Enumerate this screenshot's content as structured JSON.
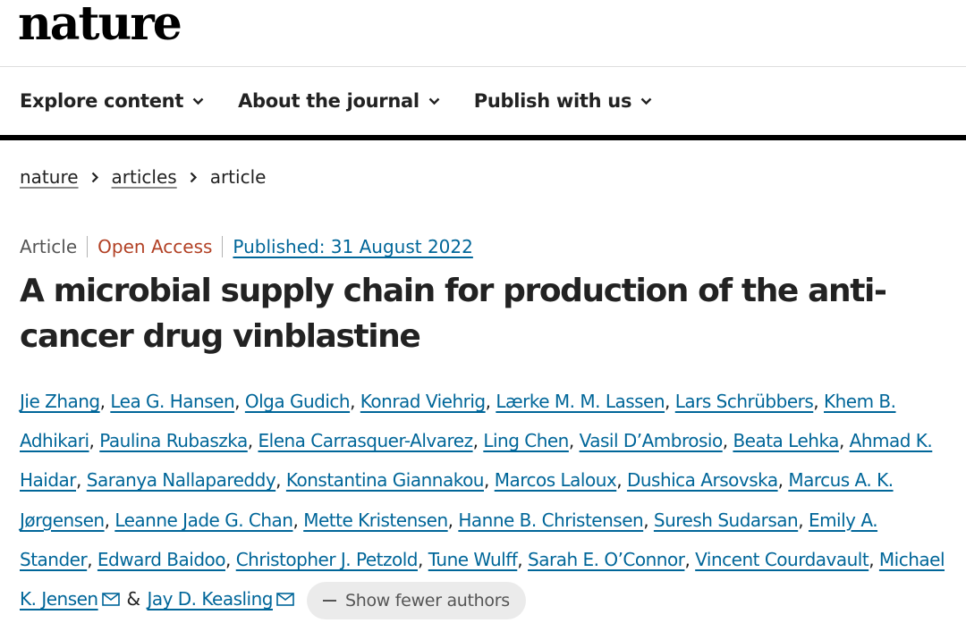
{
  "brand": {
    "logo_text": "nature"
  },
  "nav": {
    "items": [
      {
        "label": "Explore content"
      },
      {
        "label": "About the journal"
      },
      {
        "label": "Publish with us"
      }
    ]
  },
  "breadcrumb": {
    "items": [
      "nature",
      "articles",
      "article"
    ]
  },
  "meta": {
    "type": "Article",
    "access": "Open Access",
    "published": "Published: 31 August 2022"
  },
  "article": {
    "title": "A microbial supply chain for production of the anti-cancer drug vinblastine"
  },
  "authors": [
    "Jie Zhang",
    "Lea G. Hansen",
    "Olga Gudich",
    "Konrad Viehrig",
    "Lærke M. M. Lassen",
    "Lars Schrübbers",
    "Khem B. Adhikari",
    "Paulina Rubaszka",
    "Elena Carrasquer-Alvarez",
    "Ling Chen",
    "Vasil D’Ambrosio",
    "Beata Lehka",
    "Ahmad K. Haidar",
    "Saranya Nallapareddy",
    "Konstantina Giannakou",
    "Marcos Laloux",
    "Dushica Arsovska",
    "Marcus A. K. Jørgensen",
    "Leanne Jade G. Chan",
    "Mette Kristensen",
    "Hanne B. Christensen",
    "Suresh Sudarsan",
    "Emily A. Stander",
    "Edward Baidoo",
    "Christopher J. Petzold",
    "Tune Wulff",
    "Sarah E. O’Connor",
    "Vincent Courdavault"
  ],
  "corresponding_authors": [
    "Michael K. Jensen",
    "Jay D. Keasling"
  ],
  "authors_ui": {
    "amp": "&",
    "show_fewer_label": "Show fewer authors"
  },
  "colors": {
    "link": "#006699",
    "open_access": "#b24125",
    "text": "#222222"
  }
}
